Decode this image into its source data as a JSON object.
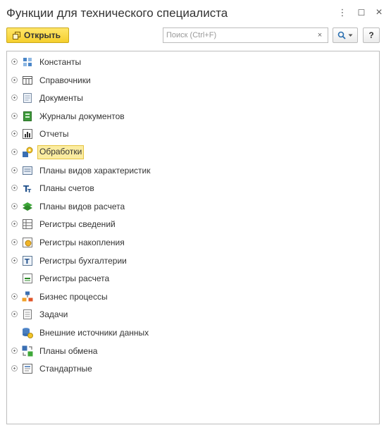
{
  "window": {
    "title": "Функции для технического специалиста",
    "more_label": "⋮",
    "maximize_label": "☐",
    "close_label": "×"
  },
  "toolbar": {
    "open_label": "Открыть",
    "search_placeholder": "Поиск (Ctrl+F)",
    "search_value": "",
    "clear_label": "×",
    "help_label": "?"
  },
  "tree": {
    "items": [
      {
        "label": "Константы",
        "icon": "constants-icon",
        "expandable": true,
        "selected": false
      },
      {
        "label": "Справочники",
        "icon": "catalogs-icon",
        "expandable": true,
        "selected": false
      },
      {
        "label": "Документы",
        "icon": "documents-icon",
        "expandable": true,
        "selected": false
      },
      {
        "label": "Журналы документов",
        "icon": "document-journals-icon",
        "expandable": true,
        "selected": false
      },
      {
        "label": "Отчеты",
        "icon": "reports-icon",
        "expandable": true,
        "selected": false
      },
      {
        "label": "Обработки",
        "icon": "data-processors-icon",
        "expandable": true,
        "selected": true
      },
      {
        "label": "Планы видов характеристик",
        "icon": "chart-of-characteristic-types-icon",
        "expandable": true,
        "selected": false
      },
      {
        "label": "Планы счетов",
        "icon": "chart-of-accounts-icon",
        "expandable": true,
        "selected": false
      },
      {
        "label": "Планы видов расчета",
        "icon": "chart-of-calculation-types-icon",
        "expandable": true,
        "selected": false
      },
      {
        "label": "Регистры сведений",
        "icon": "information-registers-icon",
        "expandable": true,
        "selected": false
      },
      {
        "label": "Регистры накопления",
        "icon": "accumulation-registers-icon",
        "expandable": true,
        "selected": false
      },
      {
        "label": "Регистры бухгалтерии",
        "icon": "accounting-registers-icon",
        "expandable": true,
        "selected": false
      },
      {
        "label": "Регистры расчета",
        "icon": "calculation-registers-icon",
        "expandable": false,
        "selected": false
      },
      {
        "label": "Бизнес процессы",
        "icon": "business-processes-icon",
        "expandable": true,
        "selected": false
      },
      {
        "label": "Задачи",
        "icon": "tasks-icon",
        "expandable": true,
        "selected": false
      },
      {
        "label": "Внешние источники данных",
        "icon": "external-data-sources-icon",
        "expandable": false,
        "selected": false
      },
      {
        "label": "Планы обмена",
        "icon": "exchange-plans-icon",
        "expandable": true,
        "selected": false
      },
      {
        "label": "Стандартные",
        "icon": "standard-icon",
        "expandable": true,
        "selected": false
      }
    ]
  },
  "colors": {
    "accent_button": "#f5cf2d",
    "selection_fill": "#fbeca0",
    "selection_border": "#e6c440",
    "border": "#bdbdbd"
  }
}
